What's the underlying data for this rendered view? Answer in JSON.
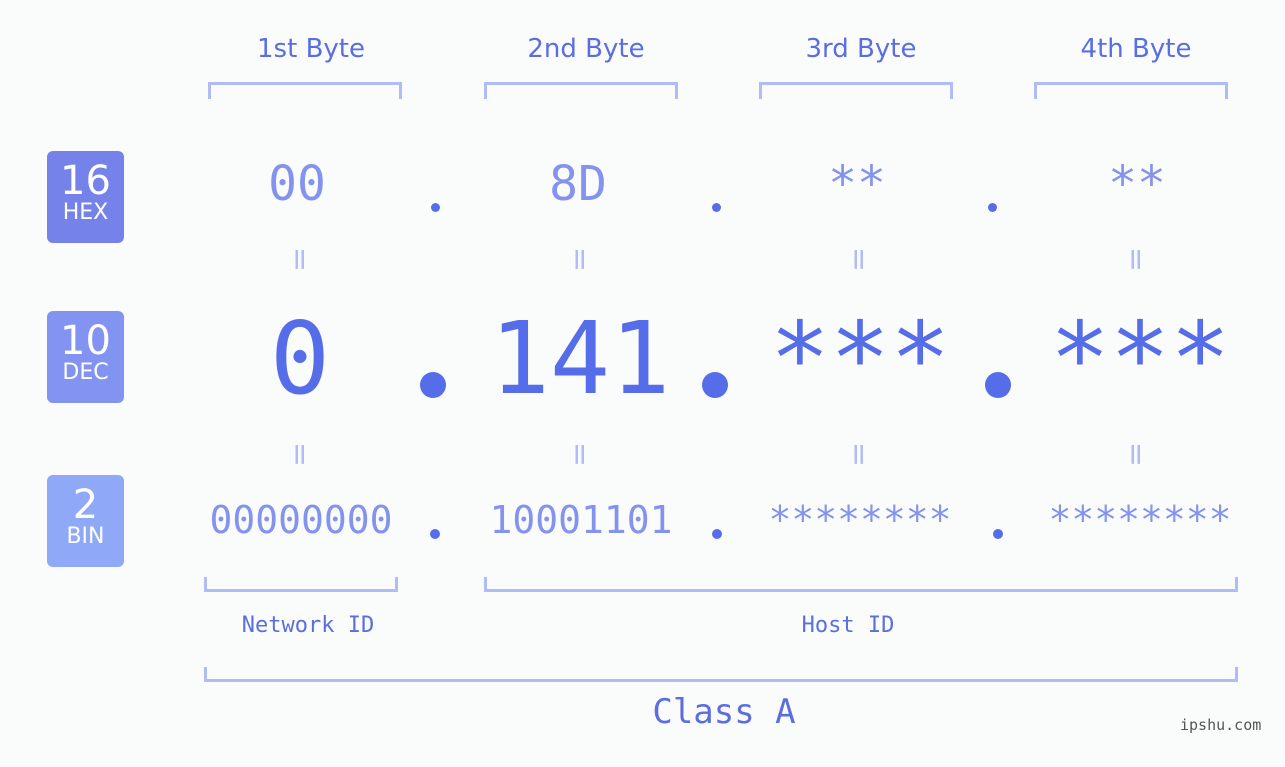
{
  "headers": [
    "1st Byte",
    "2nd Byte",
    "3rd Byte",
    "4th Byte"
  ],
  "badges": [
    {
      "number": "16",
      "label": "HEX",
      "color": "#7582ea"
    },
    {
      "number": "10",
      "label": "DEC",
      "color": "#8393f1"
    },
    {
      "number": "2",
      "label": "BIN",
      "color": "#8fa8f8"
    }
  ],
  "hex": [
    "00",
    "8D",
    "**",
    "**"
  ],
  "dec": [
    "0",
    "141",
    "***",
    "***"
  ],
  "bin": [
    "00000000",
    "10001101",
    "********",
    "********"
  ],
  "equals_sign": "=",
  "network_label": "Network ID",
  "host_label": "Host ID",
  "class_label": "Class A",
  "watermark": "ipshu.com"
}
